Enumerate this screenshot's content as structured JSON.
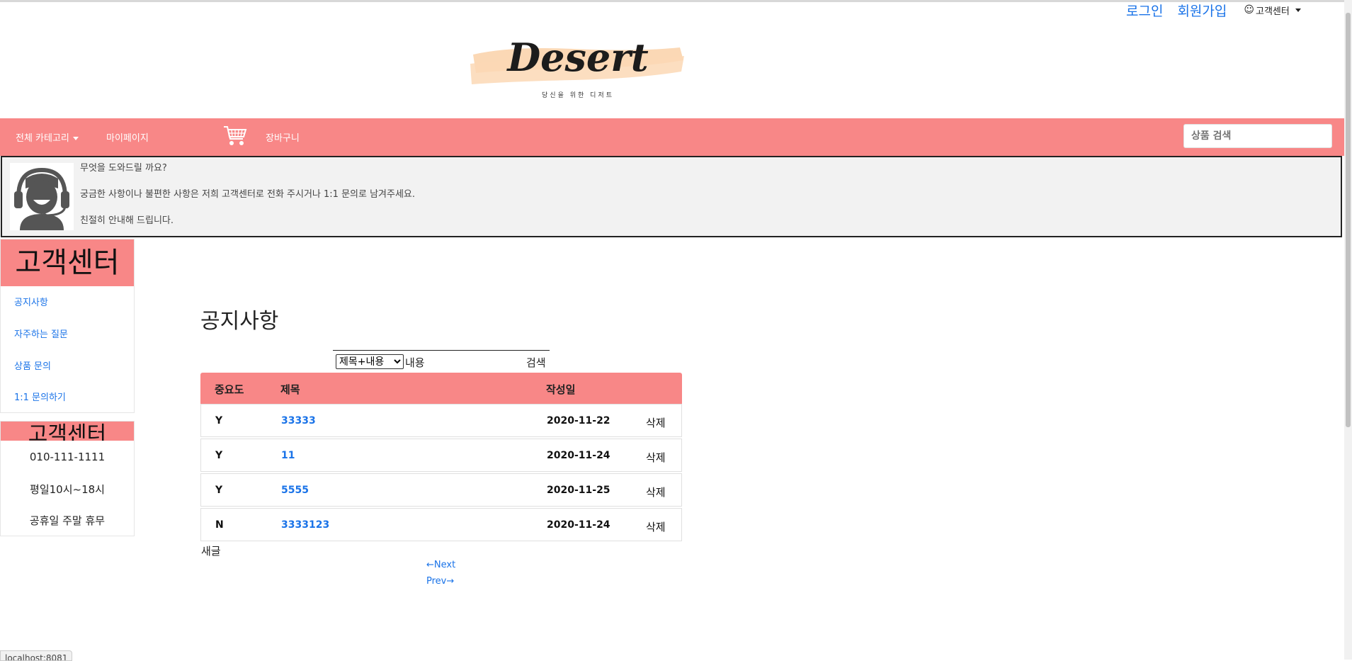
{
  "auth": {
    "login": "로그인",
    "signup": "회원가입",
    "customer_center": "고객센터",
    "customer_center_icon": "smiley-icon"
  },
  "logo": {
    "brand": "Desert",
    "tagline": "당신을 위한 디저트",
    "brush_color": "#fbd8b5"
  },
  "navbar": {
    "color": "#f88787",
    "category": "전체 카테고리",
    "mypage": "마이페이지",
    "cart_icon": "shopping-cart-icon",
    "cart": "장바구니",
    "search_placeholder": "상품 검색"
  },
  "banner": {
    "icon": "headset-agent-icon",
    "line1": "무엇을 도와드릴 까요?",
    "line2": "궁금한 사항이나 불편한 사항은 저희 고객센터로 전화 주시거나 1:1 문의로 남겨주세요.",
    "line3": "친절히 안내해 드립니다."
  },
  "sidebar": {
    "title": "고객센터",
    "items": [
      "공지사항",
      "자주하는 질문",
      "상품 문의",
      "1:1 문의하기"
    ],
    "contact_title": "고객센터",
    "phone": "010-111-1111",
    "hours": "평일10시~18시",
    "holiday": "공휴일 주말 휴무"
  },
  "main": {
    "title": "공지사항",
    "search": {
      "selected_option": "제목+내용",
      "keyword_label": "내용",
      "button": "검색"
    },
    "table": {
      "headers": [
        "중요도",
        "제목",
        "작성일"
      ],
      "rows": [
        {
          "importance": "Y",
          "title": "33333",
          "date": "2020-11-22",
          "action": "삭제"
        },
        {
          "importance": "Y",
          "title": "11",
          "date": "2020-11-24",
          "action": "삭제"
        },
        {
          "importance": "Y",
          "title": "5555",
          "date": "2020-11-25",
          "action": "삭제"
        },
        {
          "importance": "N",
          "title": "3333123",
          "date": "2020-11-24",
          "action": "삭제"
        }
      ]
    },
    "new_post": "새글",
    "pager": {
      "next": "←Next",
      "prev": "Prev→"
    }
  },
  "status_url": "localhost:8081"
}
